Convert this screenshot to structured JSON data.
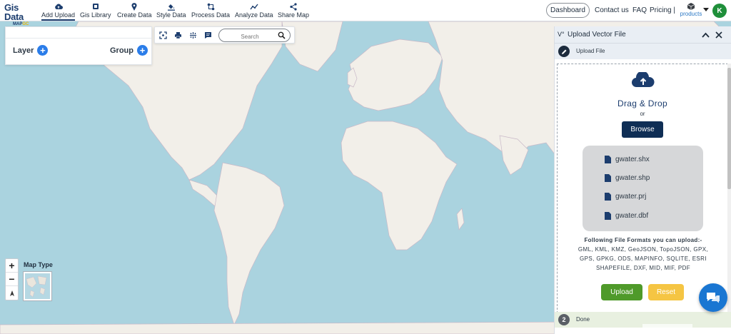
{
  "brand": {
    "name": "Gis Data",
    "sub_left": "MAP",
    "sub_right": "GC"
  },
  "nav": [
    {
      "label": "Add Upload",
      "icon": "cloud-upload-icon"
    },
    {
      "label": "Gis Library",
      "icon": "library-icon"
    },
    {
      "label": "Create Data",
      "icon": "map-pin-icon"
    },
    {
      "label": "Style Data",
      "icon": "paint-bucket-icon"
    },
    {
      "label": "Process Data",
      "icon": "process-icon"
    },
    {
      "label": "Analyze Data",
      "icon": "analyze-icon"
    },
    {
      "label": "Share Map",
      "icon": "share-icon"
    }
  ],
  "topright": {
    "dashboard": "Dashboard",
    "contact": "Contact us",
    "faq": "FAQ",
    "pricing": "Pricing |",
    "products": "products",
    "avatar_initial": "K"
  },
  "layer_panel": {
    "layer_label": "Layer",
    "group_label": "Group"
  },
  "map_tools": {
    "search_placeholder": "Search"
  },
  "map_type": {
    "label": "Map Type"
  },
  "upload_panel": {
    "title": "Upload Vector File",
    "step1_label": "Upload File",
    "drag_drop": "Drag & Drop",
    "or": "or",
    "browse": "Browse",
    "files": [
      "gwater.shx",
      "gwater.shp",
      "gwater.prj",
      "gwater.dbf"
    ],
    "formats_heading": "Following File Formats you can upload:-",
    "formats_lines": [
      "GML, KML, KMZ, GeoJSON, TopoJSON, GPX,",
      "GPS, GPKG, ODS, MAPINFO, SQLITE, ESRI",
      "SHAPEFILE, DXF, MID, MIF, PDF"
    ],
    "upload_btn": "Upload",
    "reset_btn": "Reset",
    "step2_number": "2",
    "step2_label": "Done"
  },
  "colors": {
    "brand": "#1c3d6e",
    "water": "#aad3df",
    "land": "#f2efe9",
    "accent_blue": "#2b7de9",
    "browse": "#0f2e55",
    "upload_green": "#4f9a2a",
    "reset_yellow": "#f5c543",
    "avatar_green": "#1f8f3a"
  }
}
